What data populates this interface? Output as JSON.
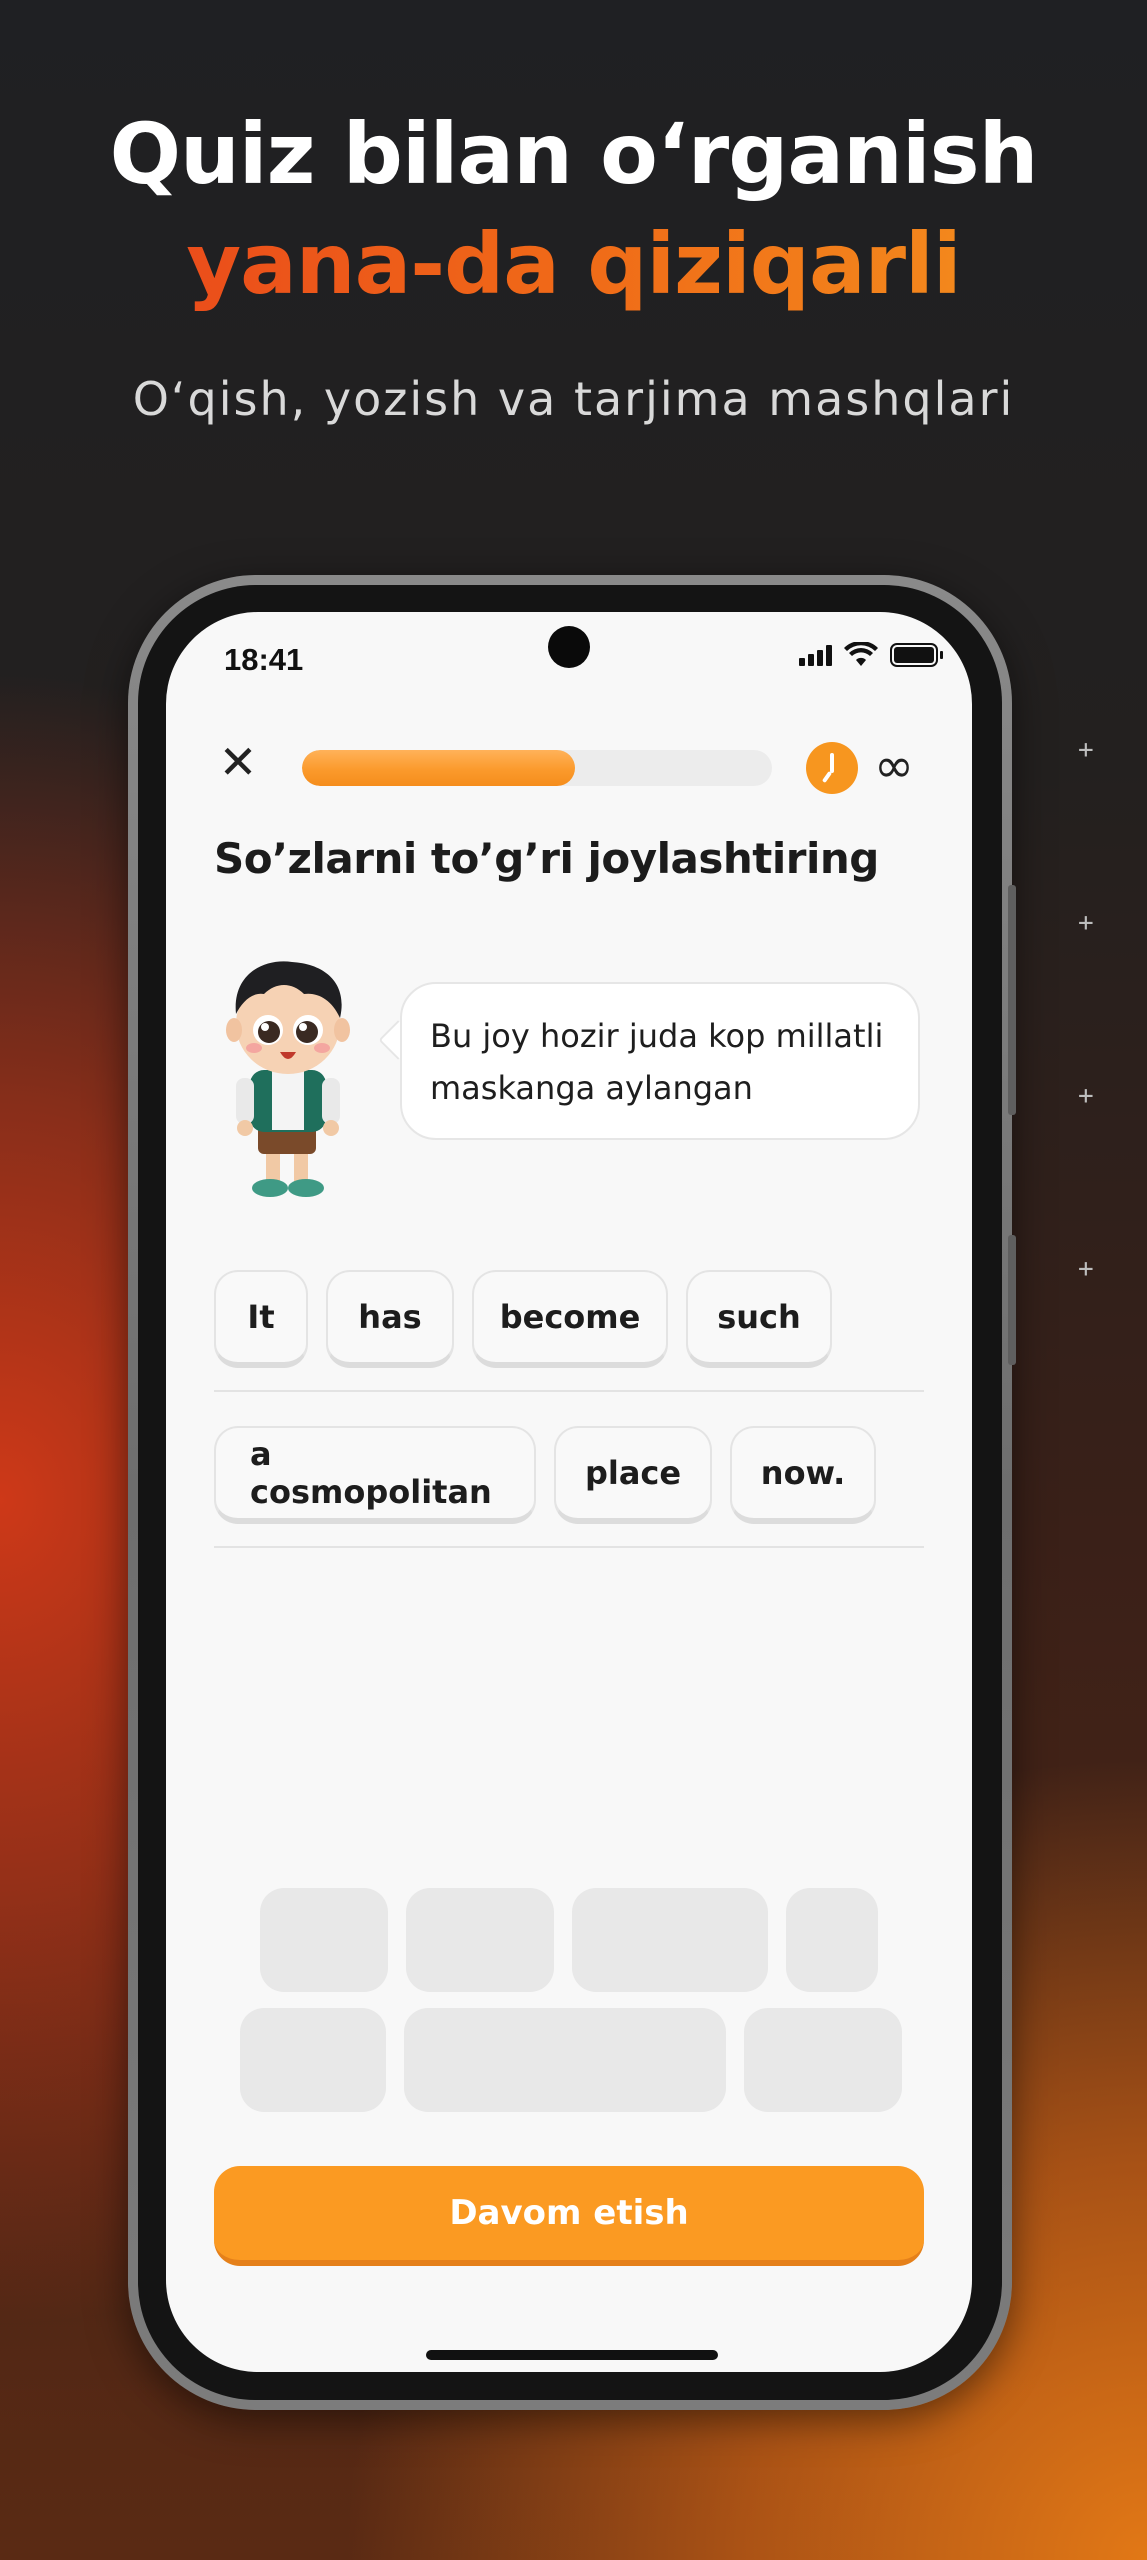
{
  "promo": {
    "headline_line1": "Quiz bilan o‘rganish",
    "headline_line2": "yana-da qiziqarli",
    "subtitle": "O‘qish, yozish va tarjima mashqlari",
    "sparkle_glyph": "+"
  },
  "status_bar": {
    "time": "18:41"
  },
  "quiz": {
    "close_glyph": "✕",
    "progress_fraction": 0.58,
    "infinity_glyph": "∞",
    "task_title": "So’zlarni to’g’ri joylashtiring",
    "sentence": "Bu joy hozir juda kop millatli maskanga aylangan",
    "word_bank": [
      "It",
      "has",
      "become",
      "such",
      "a cosmopolitan",
      "place",
      "now."
    ],
    "continue_label": "Davom etish"
  },
  "colors": {
    "accent": "#fb9a22",
    "headline_orange_start": "#e8401c",
    "headline_orange_end": "#f5961e",
    "slot_gray": "#e8e8e8"
  },
  "icons": {
    "close": "close-icon",
    "timer": "timer-icon",
    "infinity": "infinity-icon",
    "signal": "signal-icon",
    "wifi": "wifi-icon",
    "battery": "battery-icon"
  }
}
